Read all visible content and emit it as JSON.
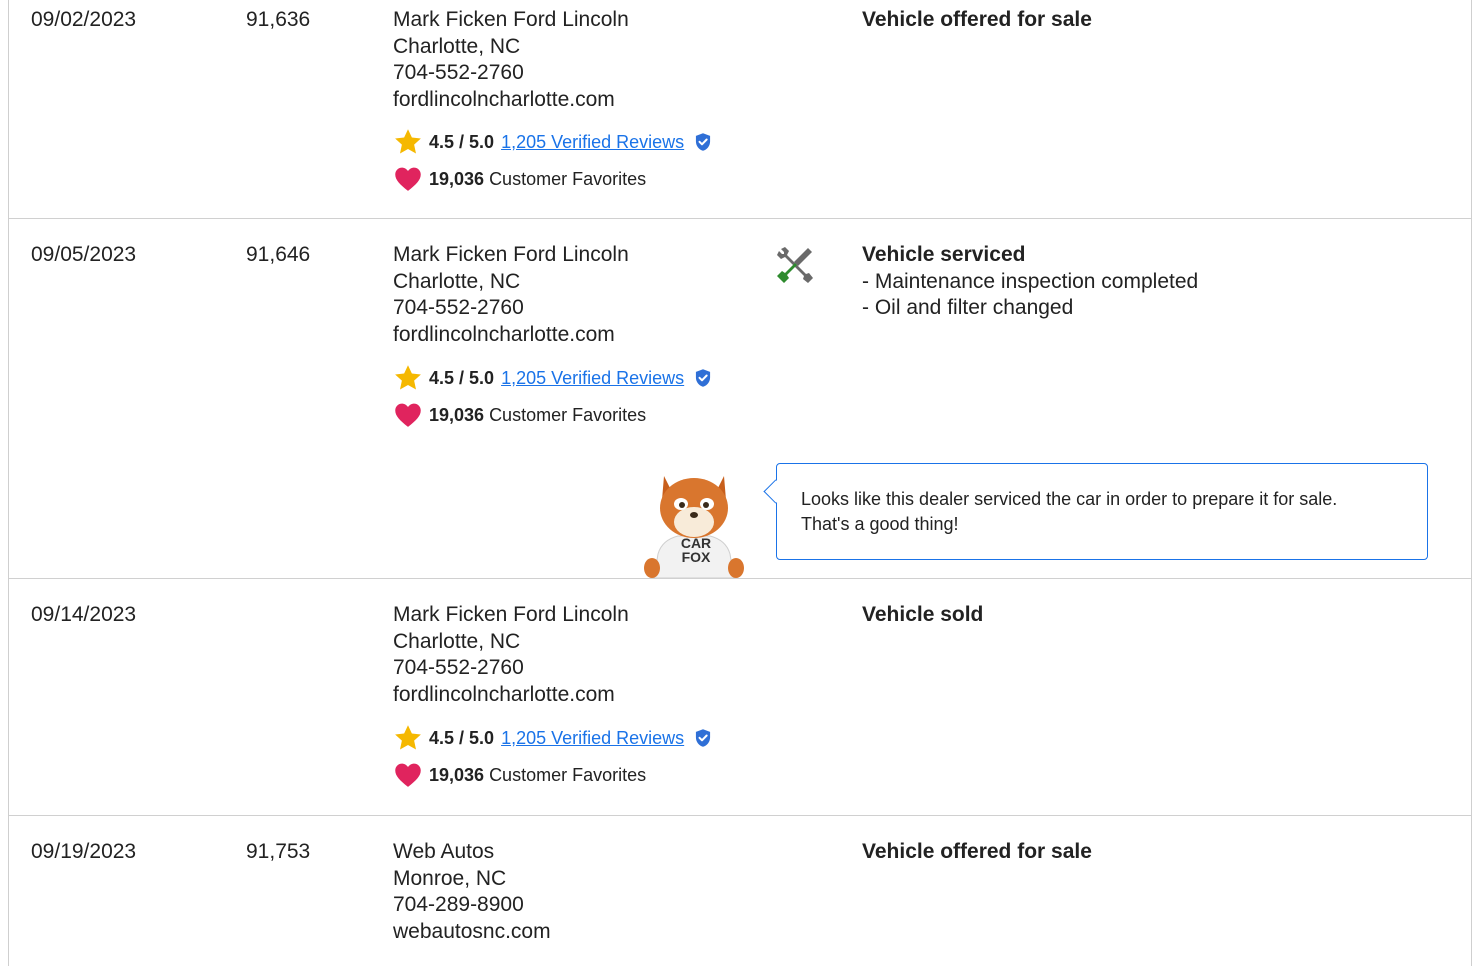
{
  "records": [
    {
      "date": "09/02/2023",
      "mileage": "91,636",
      "dealer": {
        "name": "Mark Ficken Ford Lincoln",
        "location": "Charlotte, NC",
        "phone": "704-552-2760",
        "website": "fordlincolncharlotte.com",
        "rating": "4.5 / 5.0",
        "reviews_link": "1,205 Verified Reviews",
        "favorites_count": "19,036",
        "favorites_label": "Customer Favorites"
      },
      "event_title": "Vehicle offered for sale"
    },
    {
      "date": "09/05/2023",
      "mileage": "91,646",
      "dealer": {
        "name": "Mark Ficken Ford Lincoln",
        "location": "Charlotte, NC",
        "phone": "704-552-2760",
        "website": "fordlincolncharlotte.com",
        "rating": "4.5 / 5.0",
        "reviews_link": "1,205 Verified Reviews",
        "favorites_count": "19,036",
        "favorites_label": "Customer Favorites"
      },
      "event_title": "Vehicle serviced",
      "event_details": [
        "- Maintenance inspection completed",
        "- Oil and filter changed"
      ],
      "tip": {
        "line1": "Looks like this dealer serviced the car in order to prepare it for sale.",
        "line2": "That's a good thing!"
      },
      "mascot_shirt": [
        "CAR",
        "FOX"
      ]
    },
    {
      "date": "09/14/2023",
      "mileage": "",
      "dealer": {
        "name": "Mark Ficken Ford Lincoln",
        "location": "Charlotte, NC",
        "phone": "704-552-2760",
        "website": "fordlincolncharlotte.com",
        "rating": "4.5 / 5.0",
        "reviews_link": "1,205 Verified Reviews",
        "favorites_count": "19,036",
        "favorites_label": "Customer Favorites"
      },
      "event_title": "Vehicle sold"
    },
    {
      "date": "09/19/2023",
      "mileage": "91,753",
      "dealer": {
        "name": "Web Autos",
        "location": "Monroe, NC",
        "phone": "704-289-8900",
        "website": "webautosnc.com"
      },
      "event_title": "Vehicle offered for sale"
    }
  ],
  "icons": {
    "rating": "star-icon",
    "favorites": "heart-icon",
    "verified": "verified-shield-icon",
    "service": "wrench-screwdriver-icon",
    "mascot": "carfox-mascot"
  },
  "colors": {
    "link": "#1a73e8",
    "star": "#f5b800",
    "heart": "#e0245e",
    "verified": "#2f6fd6",
    "tool_green": "#2e8b2e"
  }
}
